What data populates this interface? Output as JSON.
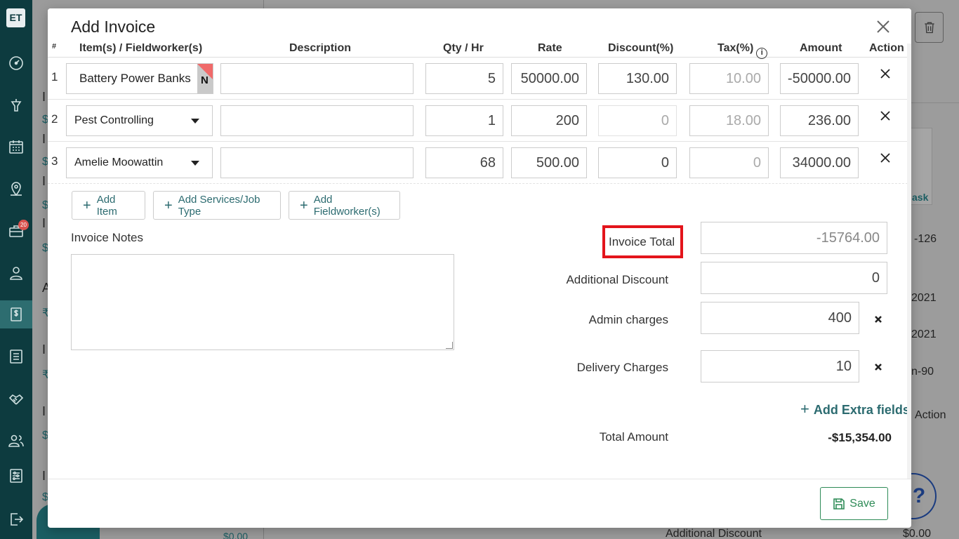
{
  "app": {
    "logo": "ET"
  },
  "sidebar": {
    "icons": [
      "dashboard-icon",
      "funnel-icon",
      "calendar-icon",
      "map-pin-icon",
      "briefcase-icon",
      "user-icon",
      "invoice-dollar-icon",
      "list-icon",
      "handshake-icon",
      "users-icon",
      "settings-sliders-icon",
      "logout-icon"
    ],
    "badge_count": "20",
    "active": "invoice-dollar-icon"
  },
  "background": {
    "list_letters": [
      "I",
      "I",
      "I",
      "I",
      "A",
      "I",
      "I",
      "I"
    ],
    "list_currency": [
      "$",
      "$",
      "$",
      "$",
      "₹",
      "₹",
      "$",
      "$"
    ],
    "list_footer_amount": "$0.00",
    "right_side_texts": [
      "-126",
      "2021",
      "2021",
      "n-90",
      "Action"
    ],
    "logo_fragment": "ask",
    "footer_label": "Additional Discount",
    "footer_value": "$0.00",
    "help_symbol": "?"
  },
  "modal": {
    "title": "Add Invoice",
    "columns": [
      "#",
      "Item(s) / Fieldworker(s)",
      "Description",
      "Qty / Hr",
      "Rate",
      "Discount(%)",
      "Tax(%)",
      "Amount",
      "Action"
    ],
    "tax_info_icon": "i",
    "rows": [
      {
        "num": "1",
        "item": "Battery Power Banks",
        "badge": "N",
        "description": "",
        "qty": "5",
        "rate": "50000.00",
        "discount": "130.00",
        "tax": "10.00",
        "amount": "-50000.00"
      },
      {
        "num": "2",
        "item": "Pest Controlling",
        "description": "",
        "qty": "1",
        "rate": "200",
        "discount": "0",
        "tax": "18.00",
        "amount": "236.00"
      },
      {
        "num": "3",
        "item": "Amelie Moowattin",
        "description": "",
        "qty": "68",
        "rate": "500.00",
        "discount": "0",
        "tax": "0",
        "amount": "34000.00"
      }
    ],
    "buttons": {
      "add_item": "Add Item",
      "add_services": "Add Services/Job Type",
      "add_fieldworker": "Add Fieldworker(s)",
      "add_extra_fields": "Add Extra fields",
      "save": "Save"
    },
    "notes": {
      "label": "Invoice Notes",
      "value": ""
    },
    "summary": {
      "invoice_total_label": "Invoice Total",
      "invoice_total_value": "-15764.00",
      "additional_discount_label": "Additional Discount",
      "additional_discount_value": "0",
      "admin_charges_label": "Admin charges",
      "admin_charges_value": "400",
      "delivery_charges_label": "Delivery Charges",
      "delivery_charges_value": "10",
      "total_amount_label": "Total Amount",
      "total_amount_value": "-$15,354.00"
    }
  },
  "colors": {
    "sidebar": "#0d3b3f",
    "accent": "#2c6b70",
    "save": "#2e8b57",
    "highlight": "#e3141b"
  }
}
